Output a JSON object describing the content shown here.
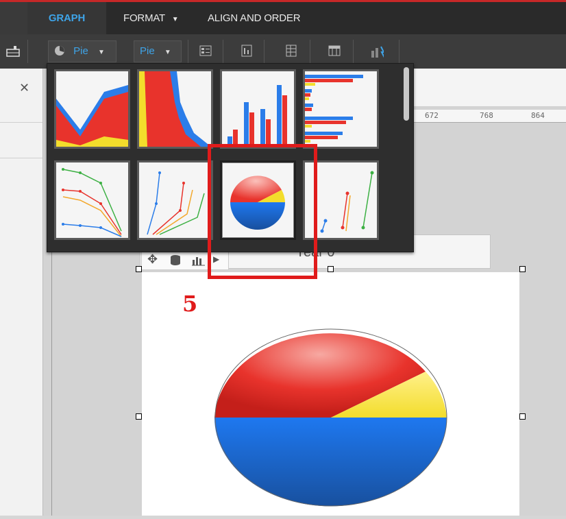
{
  "ribbon": {
    "tabs": [
      {
        "label": "GRAPH",
        "active": true
      },
      {
        "label": "FORMAT",
        "has_dropdown": true
      },
      {
        "label": "ALIGN AND ORDER"
      }
    ]
  },
  "toolbar": {
    "chart_type_label": "Pie",
    "chart_subtype_label": "Pie",
    "icons": [
      "chart-type-icon",
      "legend-icon",
      "data-values-icon",
      "grid-icon",
      "table-icon",
      "bar-analysis-icon"
    ]
  },
  "ruler": {
    "ticks": [
      "672",
      "768",
      "864"
    ]
  },
  "report": {
    "header_text": "Year 0"
  },
  "gallery": {
    "items": [
      {
        "name": "area-chart-thumb",
        "selected": false
      },
      {
        "name": "stacked-area-vertical-thumb",
        "selected": false
      },
      {
        "name": "vertical-bar-thumb",
        "selected": false
      },
      {
        "name": "horizontal-bar-thumb",
        "selected": false
      },
      {
        "name": "line-chart-thumb",
        "selected": false
      },
      {
        "name": "vertical-line-thumb",
        "selected": false
      },
      {
        "name": "pie-chart-thumb",
        "selected": true
      },
      {
        "name": "scatter-chart-thumb",
        "selected": false
      }
    ]
  },
  "annotation": {
    "step_number": "5",
    "color": "#e01b1b"
  },
  "colors": {
    "accent_blue": "#3ea4e8",
    "series_red": "#e8332c",
    "series_blue": "#1e6fe0",
    "series_yellow": "#f3dd2c",
    "series_green": "#3cb043"
  }
}
